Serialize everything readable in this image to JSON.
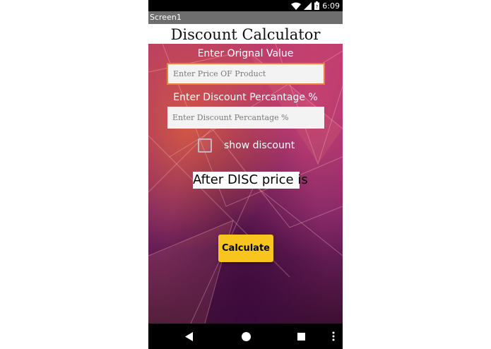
{
  "status_bar": {
    "time": "6:09",
    "icons": [
      "wifi-icon",
      "signal-icon",
      "battery-icon"
    ]
  },
  "window": {
    "title": "Screen1"
  },
  "app": {
    "heading": "Discount Calculator",
    "price_label": "Enter Orignal Value",
    "price_input": {
      "value": "",
      "placeholder": "Enter Price OF Product"
    },
    "discount_label": "Enter Discount Percantage %",
    "discount_input": {
      "value": "",
      "placeholder": "Enter Discount Percantage %"
    },
    "show_discount": {
      "label": "show discount",
      "checked": false
    },
    "result_text": "After DISC price is",
    "calculate_label": "Calculate"
  },
  "nav_bar": {
    "icons": [
      "back-icon",
      "home-icon",
      "recent-apps-icon",
      "overflow-menu-icon"
    ]
  },
  "colors": {
    "accent_input_border": "#e8833a",
    "button": "#f7c51d",
    "title_bar": "#6e6e6e"
  }
}
